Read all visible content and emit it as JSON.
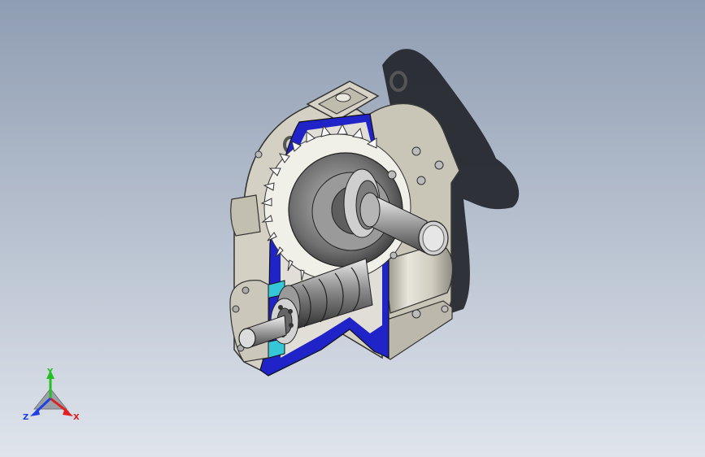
{
  "viewport": {
    "background_top": "#8f9db2",
    "background_bottom": "#dfe4ec"
  },
  "model": {
    "housing_color": "#d4d1c4",
    "section_color": "#1f23c8",
    "accent_cyan": "#35c7d8",
    "shadow_color": "#23252b"
  },
  "triad": {
    "x_label": "X",
    "y_label": "Y",
    "z_label": "Z",
    "x_color": "#e02020",
    "y_color": "#22c022",
    "z_color": "#2040e0"
  }
}
